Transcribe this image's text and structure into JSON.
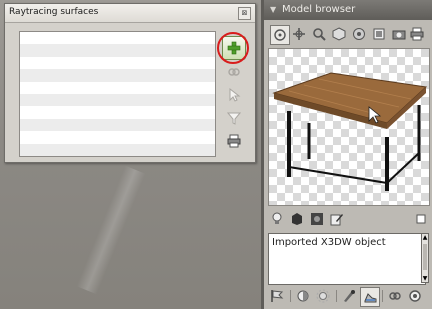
{
  "raytracing_dialog": {
    "title": "Raytracing surfaces",
    "close_label": "⊠",
    "list_rows": 10
  },
  "model_browser": {
    "title": "Model browser",
    "collapse_arrow": "▼",
    "description_text": "Imported X3DW object",
    "scroll_up": "▲",
    "scroll_down": "▼"
  },
  "colors": {
    "highlight": "#d81c1c",
    "add_green": "#4f9d2a",
    "table_wood": "#9a6a3c"
  },
  "icons": {
    "sidebar": [
      "add-icon",
      "link-icon",
      "cursor-icon",
      "filter-icon",
      "print-icon"
    ],
    "top_toolbar": [
      "rotate-icon",
      "move-icon",
      "zoom-icon",
      "cube-icon",
      "sphere-icon",
      "frame-icon",
      "camera-icon",
      "print-icon"
    ],
    "mid_toolbar": [
      "bulb-icon",
      "object-icon",
      "material-icon",
      "edit-icon",
      "square-icon"
    ],
    "bottom_toolbar": [
      "flag-icon",
      "contrast-icon",
      "sun-icon",
      "brush-icon",
      "shoe-icon",
      "link-icon",
      "circle-icon"
    ]
  }
}
